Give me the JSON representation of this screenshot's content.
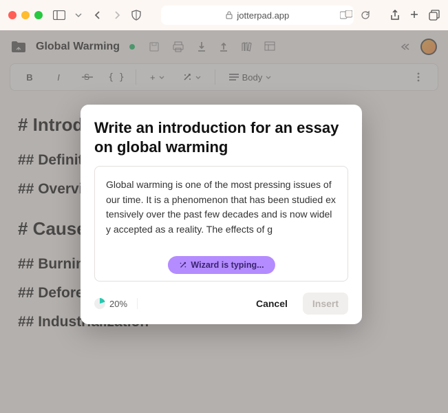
{
  "chrome": {
    "url": "jotterpad.app"
  },
  "app": {
    "doc_title": "Global Warming"
  },
  "formatbar": {
    "bold": "B",
    "italic": "I",
    "braces": "{ }",
    "plus": "+",
    "body_label": "Body"
  },
  "doc": {
    "h1_intro": "# Introduction",
    "h2_def": "## Definition",
    "h2_ovw": "## Overview",
    "h1_causes": "# Causes",
    "h2_burn": "## Burning",
    "h2_defo": "## Deforestation",
    "h2_ind": "## Industrialization"
  },
  "modal": {
    "title": "Write an introduction for an essay on global warming",
    "generated": "Global warming is one of the most pressing issues of our time. It is a phenomenon that has been studied extensively over the past few decades and is now widely accepted as a reality. The effects of g",
    "typing": "Wizard is typing...",
    "pct": "20%",
    "cancel": "Cancel",
    "insert": "Insert"
  }
}
